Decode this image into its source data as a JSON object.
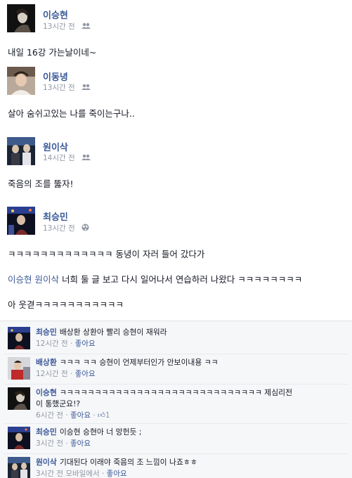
{
  "posts": [
    {
      "author": "이승현",
      "time": "13시간 전",
      "audience_icon": "friends-icon",
      "text": "내일 16강 가는날이네~"
    },
    {
      "author": "이동녕",
      "time": "13시간 전",
      "audience_icon": "friends-icon",
      "text": "살아 숨쉬고있는 나를 죽이는구나.."
    },
    {
      "author": "원이삭",
      "time": "14시간 전",
      "audience_icon": "friends-icon",
      "text": "죽음의 조를 뚫자!"
    },
    {
      "author": "최승민",
      "time": "13시간 전",
      "audience_icon": "globe-icon",
      "line1": "ㅋㅋㅋㅋㅋㅋㅋㅋㅋㅋㅋㅋㅋ 동녕이 자러 들어 갔다가",
      "line2_mention1": "이승현",
      "line2_mention2": "원이삭",
      "line2_rest": " 너희 둘 글 보고 다시 일어나서 연습하러 나왔다 ㅋㅋㅋㅋㅋㅋㅋㅋ",
      "line3": "아 웃겯ㅋㅋㅋㅋㅋㅋㅋㅋㅋㅋㅋ"
    }
  ],
  "comments": [
    {
      "author": "최승민",
      "text": "배상환 상환아 빨리 승현이 재워라",
      "time": "12시간 전",
      "like_label": "좋아요"
    },
    {
      "author": "배상환",
      "text": "ㅋㅋㅋ ㅋㅋ 승현이 언제부터인가 안보이내용 ㅋㅋ",
      "time": "12시간 전",
      "like_label": "좋아요"
    },
    {
      "author": "이승현",
      "text": "ㅋㅋㅋㅋㅋㅋㅋㅋㅋㅋㅋㅋㅋㅋㅋㅋㅋㅋㅋㅋㅋㅋㅋㅋㅋㅋㅋㅋㅋ 제심리전",
      "text2": "이 통했군요!?",
      "time": "6시간 전",
      "like_label": "좋아요",
      "like_count": "1"
    },
    {
      "author": "최승민",
      "text": "이승현 승현아 너 망헌듯 ;",
      "time": "3시간 전",
      "like_label": "좋아요"
    },
    {
      "author": "원이삭",
      "text": "기대된다 이래야 죽음의 조 느낌이 나죠ㅎㅎ",
      "time": "3시간 전",
      "via": "모바일에서",
      "like_label": "좋아요"
    }
  ],
  "separator": " · "
}
